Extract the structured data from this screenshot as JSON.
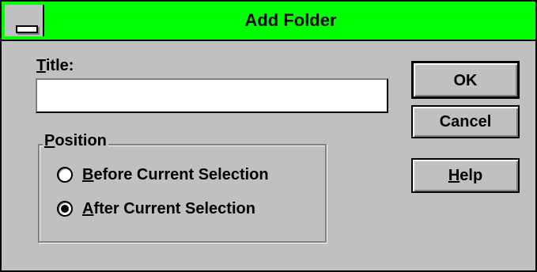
{
  "window": {
    "title": "Add Folder",
    "titlebar_color": "#00ff00"
  },
  "form": {
    "title_label_mnemonic": "T",
    "title_label_rest": "itle:",
    "title_value": "",
    "position_label_mnemonic": "P",
    "position_label_rest": "osition",
    "options": [
      {
        "mnemonic": "B",
        "rest": "efore Current Selection",
        "selected": false
      },
      {
        "mnemonic": "A",
        "rest": "fter Current Selection",
        "selected": true
      }
    ]
  },
  "buttons": {
    "ok": "OK",
    "cancel": "Cancel",
    "help_mnemonic": "H",
    "help_rest": "elp"
  },
  "icons": {
    "system_menu": "system-menu-icon"
  }
}
